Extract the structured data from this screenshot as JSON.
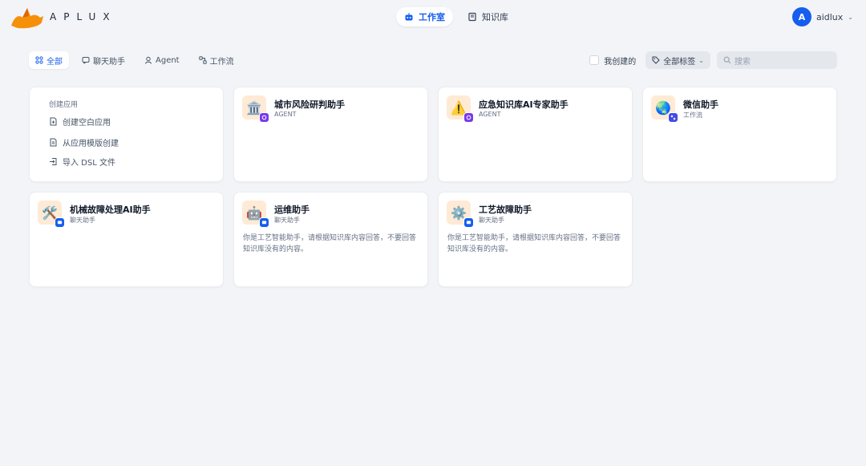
{
  "header": {
    "logo_text": "APLUX",
    "nav": [
      {
        "label": "工作室",
        "active": true,
        "icon": "robot-icon"
      },
      {
        "label": "知识库",
        "active": false,
        "icon": "book-icon"
      }
    ],
    "user": {
      "initial": "A",
      "name": "aidlux"
    }
  },
  "tabs": [
    {
      "label": "全部",
      "active": true,
      "icon": "grid-icon"
    },
    {
      "label": "聊天助手",
      "active": false,
      "icon": "chat-icon"
    },
    {
      "label": "Agent",
      "active": false,
      "icon": "agent-icon"
    },
    {
      "label": "工作流",
      "active": false,
      "icon": "workflow-icon"
    }
  ],
  "filters": {
    "mine_label": "我创建的",
    "tag_label": "全部标签",
    "search_placeholder": "搜索"
  },
  "create": {
    "title": "创建应用",
    "items": [
      {
        "label": "创建空白应用",
        "icon": "file-plus-icon"
      },
      {
        "label": "从应用模版创建",
        "icon": "template-icon"
      },
      {
        "label": "导入 DSL 文件",
        "icon": "import-icon"
      }
    ]
  },
  "apps": [
    {
      "name": "城市风险研判助手",
      "type": "AGENT",
      "emoji": "🏛️",
      "badge": "agent",
      "desc": ""
    },
    {
      "name": "应急知识库AI专家助手",
      "type": "AGENT",
      "emoji": "⚠️",
      "badge": "agent",
      "desc": ""
    },
    {
      "name": "微信助手",
      "type": "工作流",
      "emoji": "🌏",
      "badge": "flow",
      "desc": ""
    },
    {
      "name": "机械故障处理AI助手",
      "type": "聊天助手",
      "emoji": "🛠️",
      "badge": "chat",
      "desc": ""
    },
    {
      "name": "运维助手",
      "type": "聊天助手",
      "emoji": "🤖",
      "badge": "chat",
      "desc": "你是工艺智能助手，请根据知识库内容回答，不要回答知识库没有的内容。"
    },
    {
      "name": "工艺故障助手",
      "type": "聊天助手",
      "emoji": "⚙️",
      "badge": "chat",
      "desc": "你是工艺智能助手，请根据知识库内容回答，不要回答知识库没有的内容。"
    }
  ],
  "colors": {
    "accent": "#155eef",
    "background": "#f2f4f7",
    "logo": "#f79009"
  }
}
